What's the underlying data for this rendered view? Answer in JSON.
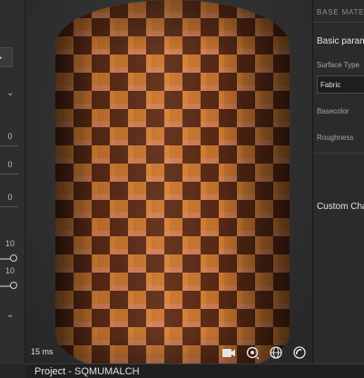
{
  "left_panel": {
    "dropdown_caret": "▸",
    "chevron": "⌄",
    "values": [
      "0",
      "0",
      "0",
      "10",
      "10"
    ]
  },
  "viewport": {
    "frame_time": "15 ms",
    "tools": [
      "camera-icon",
      "rotate-view-icon",
      "globe-icon",
      "environment-icon"
    ]
  },
  "status_bar": {
    "project": "Project - SQMUMALCH"
  },
  "properties": {
    "header": "BASE MATERIAL",
    "section_basic": "Basic parameters",
    "surface_type_label": "Surface Type",
    "surface_type_value": "Fabric",
    "basecolor_label": "Basecolor",
    "roughness_label": "Roughness",
    "section_custom": "Custom Channels"
  },
  "colors": {
    "panel": "#2b2b2b",
    "viewport": "#303030",
    "fabric_orange": "#c8742e",
    "fabric_brown": "#5a2a16"
  }
}
